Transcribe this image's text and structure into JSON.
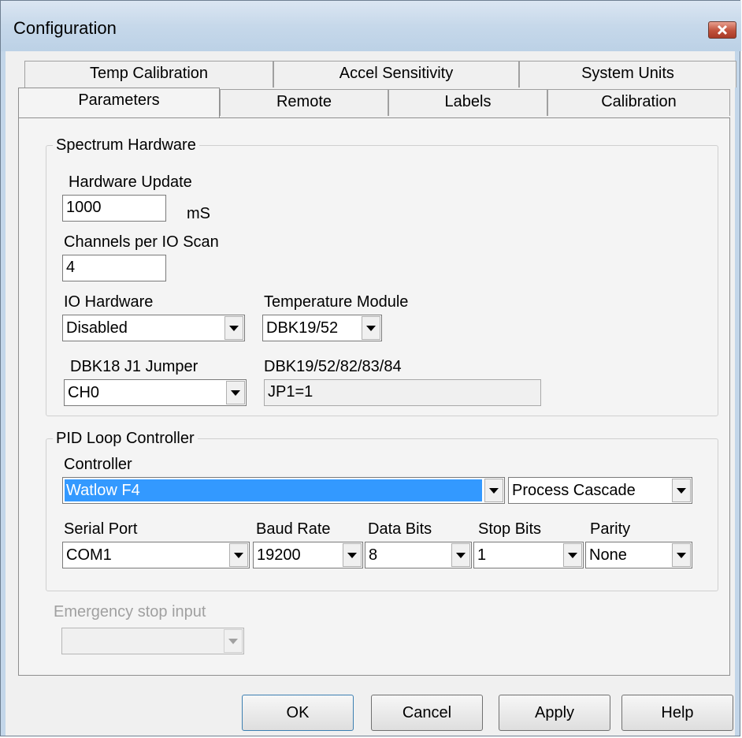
{
  "window": {
    "title": "Configuration"
  },
  "tabs": {
    "row1": [
      "Temp Calibration",
      "Accel Sensitivity",
      "System Units"
    ],
    "row2": [
      "Parameters",
      "Remote",
      "Labels",
      "Calibration"
    ]
  },
  "spectrum_hardware": {
    "title": "Spectrum Hardware",
    "hardware_update_label": "Hardware Update",
    "hardware_update_value": "1000",
    "hardware_update_unit": "mS",
    "channels_label": "Channels per IO Scan",
    "channels_value": "4",
    "io_hardware_label": "IO Hardware",
    "io_hardware_value": "Disabled",
    "temp_module_label": "Temperature Module",
    "temp_module_value": "DBK19/52",
    "dbk18_label": "DBK18  J1 Jumper",
    "dbk18_value": "CH0",
    "dbk19_label": "DBK19/52/82/83/84",
    "dbk19_value": "JP1=1"
  },
  "pid": {
    "title": "PID Loop Controller",
    "controller_label": "Controller",
    "controller_value": "Watlow F4",
    "mode_value": "Process Cascade",
    "serial_port_label": "Serial Port",
    "serial_port_value": "COM1",
    "baud_rate_label": "Baud Rate",
    "baud_rate_value": "19200",
    "data_bits_label": "Data Bits",
    "data_bits_value": "8",
    "stop_bits_label": "Stop Bits",
    "stop_bits_value": "1",
    "parity_label": "Parity",
    "parity_value": "None"
  },
  "emergency": {
    "label": "Emergency stop input",
    "value": ""
  },
  "buttons": {
    "ok": "OK",
    "cancel": "Cancel",
    "apply": "Apply",
    "help": "Help"
  }
}
